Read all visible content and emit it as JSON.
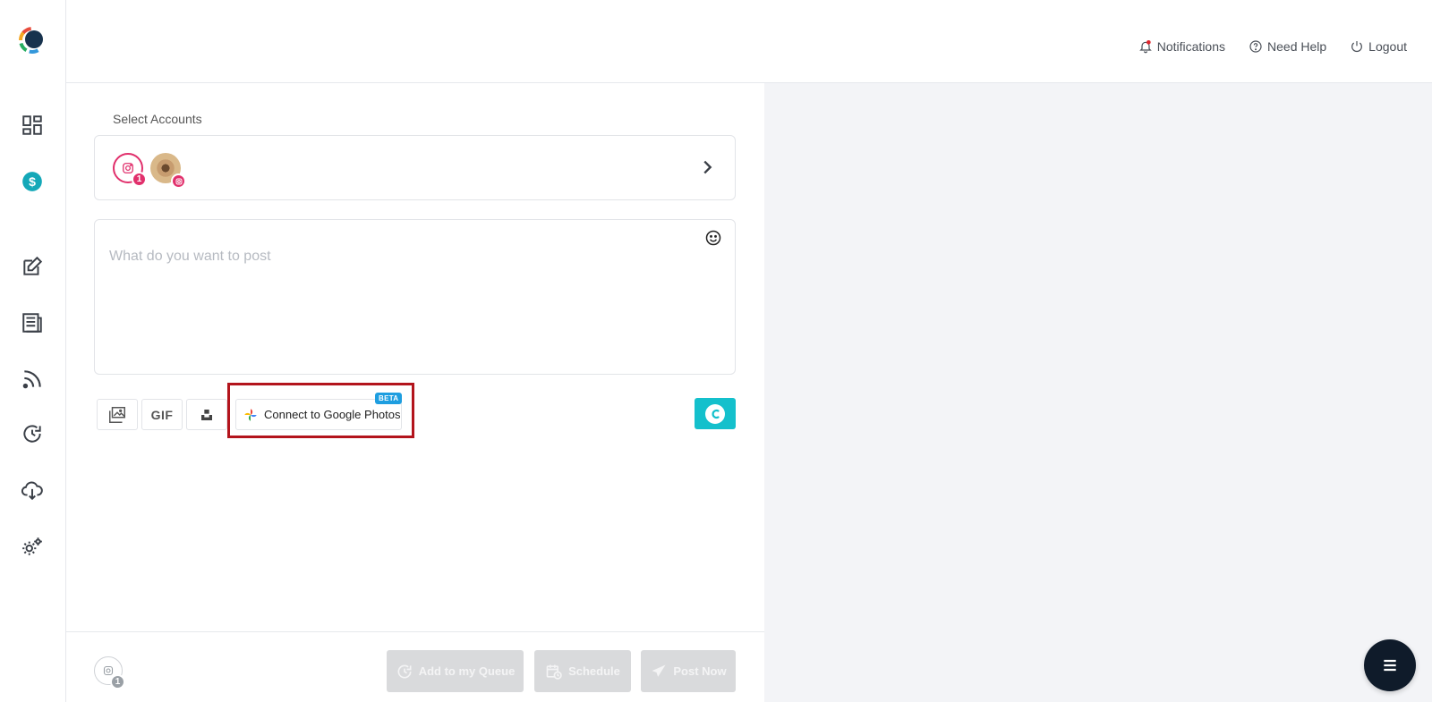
{
  "header": {
    "notifications": "Notifications",
    "need_help": "Need Help",
    "logout": "Logout"
  },
  "sidebar": {
    "items": [
      {
        "icon": "dashboard-icon"
      },
      {
        "icon": "billing-icon"
      },
      {
        "icon": "compose-icon"
      },
      {
        "icon": "posts-icon"
      },
      {
        "icon": "rss-feed-icon"
      },
      {
        "icon": "queue-icon"
      },
      {
        "icon": "cloud-download-icon"
      },
      {
        "icon": "settings-icon"
      }
    ]
  },
  "composer": {
    "select_accounts_label": "Select Accounts",
    "selected_count": "1",
    "post_placeholder": "What do you want to post",
    "tools": {
      "gif_label": "GIF",
      "google_photos_label": "Connect to Google Photos",
      "beta_badge": "BETA"
    }
  },
  "footer": {
    "account_count": "1",
    "add_to_queue": "Add to my Queue",
    "schedule": "Schedule",
    "post_now": "Post Now"
  },
  "colors": {
    "accent": "#14c0cc",
    "instagram": "#e1306c",
    "highlight": "#b3141c",
    "disabled_button": "#d9dadc"
  }
}
